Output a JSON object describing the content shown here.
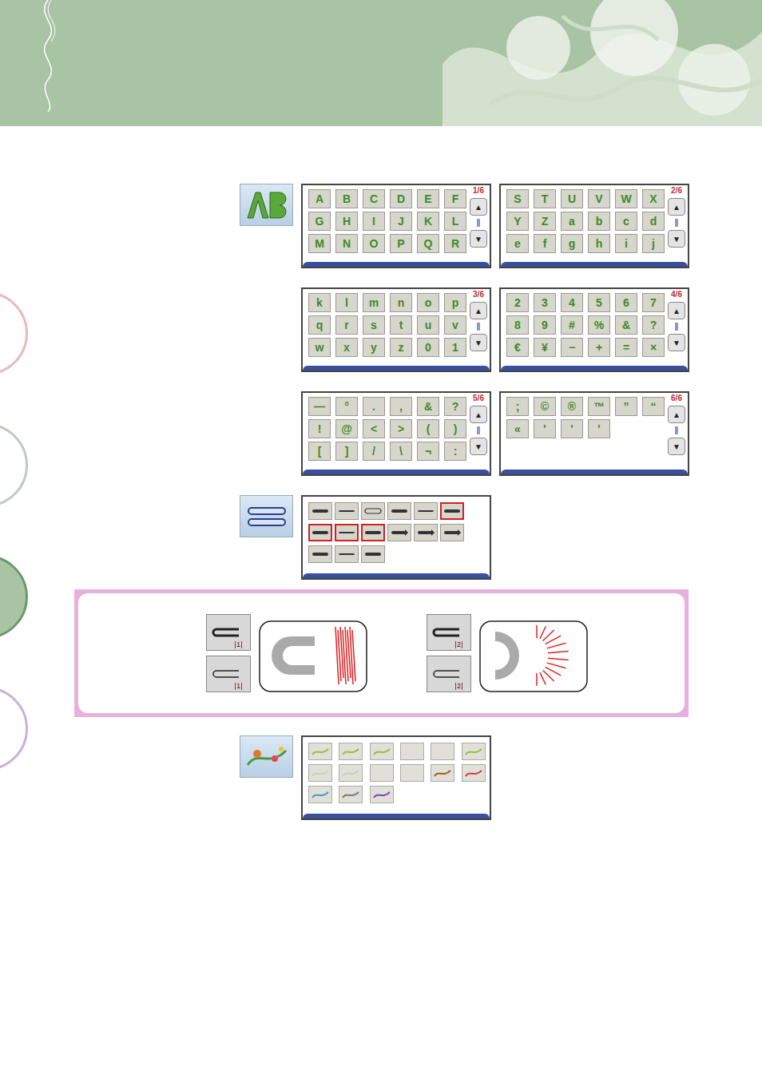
{
  "scroll_up": "▲",
  "scroll_down": "▼",
  "character_screens": [
    {
      "page_label": "1/6",
      "keys": [
        "A",
        "B",
        "C",
        "D",
        "E",
        "F",
        "G",
        "H",
        "I",
        "J",
        "K",
        "L",
        "M",
        "N",
        "O",
        "P",
        "Q",
        "R"
      ]
    },
    {
      "page_label": "2/6",
      "keys": [
        "S",
        "T",
        "U",
        "V",
        "W",
        "X",
        "Y",
        "Z",
        "a",
        "b",
        "c",
        "d",
        "e",
        "f",
        "g",
        "h",
        "i",
        "j"
      ]
    },
    {
      "page_label": "3/6",
      "keys": [
        "k",
        "l",
        "m",
        "n",
        "o",
        "p",
        "q",
        "r",
        "s",
        "t",
        "u",
        "v",
        "w",
        "x",
        "y",
        "z",
        "0",
        "1"
      ]
    },
    {
      "page_label": "4/6",
      "keys": [
        "2",
        "3",
        "4",
        "5",
        "6",
        "7",
        "8",
        "9",
        "#",
        "%",
        "&",
        "?",
        "€",
        "¥",
        "−",
        "+",
        "=",
        "×"
      ]
    },
    {
      "page_label": "5/6",
      "keys": [
        "—",
        "°",
        ".",
        ",",
        "&",
        "?",
        "!",
        "@",
        "<",
        ">",
        "(",
        ")",
        "[",
        "]",
        "/",
        "\\",
        "¬",
        ":"
      ]
    },
    {
      "page_label": "6/6",
      "keys": [
        ";",
        "©",
        "®",
        "™",
        "”",
        "“",
        "«",
        "'",
        "'",
        "'"
      ]
    }
  ],
  "frame_screen": {
    "keys": [
      {
        "kind": "bold",
        "selected": false
      },
      {
        "kind": "thin",
        "selected": false
      },
      {
        "kind": "double",
        "selected": false
      },
      {
        "kind": "bold",
        "selected": false
      },
      {
        "kind": "thin",
        "selected": false
      },
      {
        "kind": "bold",
        "selected": true
      },
      {
        "kind": "bold",
        "selected": true
      },
      {
        "kind": "thin",
        "selected": true
      },
      {
        "kind": "bold",
        "selected": true
      },
      {
        "kind": "arrow",
        "selected": false
      },
      {
        "kind": "arrow",
        "selected": false
      },
      {
        "kind": "arrow",
        "selected": false
      },
      {
        "kind": "bold",
        "selected": false
      },
      {
        "kind": "thin",
        "selected": false
      },
      {
        "kind": "bold",
        "selected": false
      }
    ]
  },
  "frame_examples": [
    {
      "top_label": "1",
      "bottom_label": "1",
      "stitch": "zigzag"
    },
    {
      "top_label": "2",
      "bottom_label": "2",
      "stitch": "fan"
    }
  ],
  "decorative_screen": {
    "keys": [
      {
        "color": "#9bbf3a"
      },
      {
        "color": "#9bbf3a"
      },
      {
        "color": "#9bbf3a"
      },
      {
        "color": "#dddddd"
      },
      {
        "color": "#dddddd"
      },
      {
        "color": "#9bbf3a"
      },
      {
        "color": "#c9d4a0"
      },
      {
        "color": "#c9d4a0"
      },
      {
        "color": "#dddddd"
      },
      {
        "color": "#dddddd"
      },
      {
        "color": "#a05a2a"
      },
      {
        "color": "#d04040"
      },
      {
        "color": "#4a9ad0"
      },
      {
        "color": "#777777"
      },
      {
        "color": "#7a4ab0"
      }
    ]
  }
}
